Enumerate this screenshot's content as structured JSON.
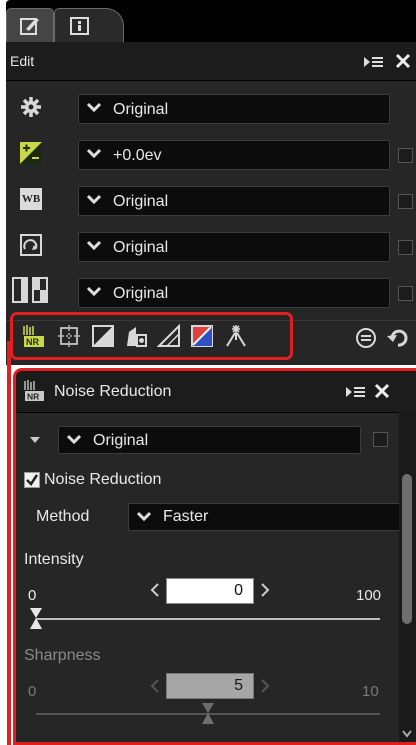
{
  "tabs": [
    {
      "name": "edit-tab",
      "icon": "edit-icon"
    },
    {
      "name": "info-tab",
      "icon": "info-icon"
    }
  ],
  "edit_panel": {
    "title": "Edit",
    "rows": [
      {
        "icon": "gear-icon",
        "value": "Original",
        "has_checkbox": false
      },
      {
        "icon": "exposure-compensation-icon",
        "value": "+0.0ev",
        "has_checkbox": true
      },
      {
        "icon": "white-balance-icon",
        "icon_text": "WB",
        "value": "Original",
        "has_checkbox": true
      },
      {
        "icon": "picture-control-icon",
        "value": "Original",
        "has_checkbox": true
      },
      {
        "icon": "active-d-lighting-icon",
        "value": "Original",
        "has_checkbox": true
      }
    ],
    "toolbar": [
      {
        "name": "noise-reduction-tool",
        "label": "NR"
      },
      {
        "name": "straighten-tool"
      },
      {
        "name": "levels-curves-tool"
      },
      {
        "name": "camera-lens-corrections-tool"
      },
      {
        "name": "perspective-tool"
      },
      {
        "name": "color-adjust-tool"
      },
      {
        "name": "retouch-brush-tool"
      }
    ]
  },
  "noise_panel": {
    "title": "Noise Reduction",
    "title_icon_text": "NR",
    "preset": "Original",
    "checkbox_label": "Noise Reduction",
    "checkbox_checked": true,
    "method_label": "Method",
    "method_value": "Faster",
    "intensity": {
      "label": "Intensity",
      "min": "0",
      "max": "100",
      "value": "0",
      "level": 0
    },
    "sharpness": {
      "label": "Sharpness",
      "min": "0",
      "max": "10",
      "value": "5",
      "level": 0.5,
      "disabled": true
    }
  },
  "colors": {
    "highlight": "#e02020",
    "panel": "#262626",
    "header": "#1c1c1c"
  }
}
